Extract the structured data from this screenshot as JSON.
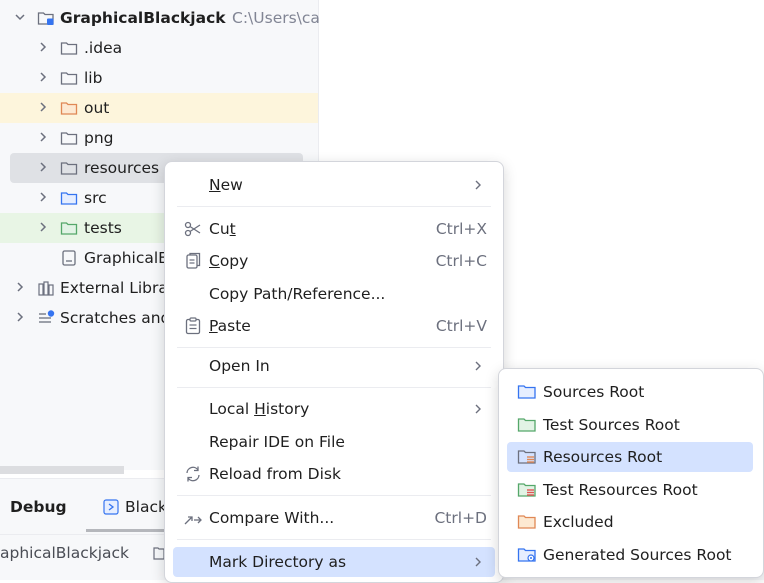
{
  "project_tree": {
    "root": {
      "name": "GraphicalBlackjack",
      "path": "C:\\Users\\ca"
    },
    "items": [
      {
        "label": ".idea",
        "icon": "folder-icon"
      },
      {
        "label": "lib",
        "icon": "folder-icon"
      },
      {
        "label": "out",
        "icon": "excluded-folder-icon"
      },
      {
        "label": "png",
        "icon": "folder-icon"
      },
      {
        "label": "resources",
        "icon": "folder-icon"
      },
      {
        "label": "src",
        "icon": "source-folder-icon"
      },
      {
        "label": "tests",
        "icon": "test-folder-icon"
      },
      {
        "label": "GraphicalBl",
        "icon": "file-icon"
      }
    ],
    "external_libraries": "External Libra",
    "scratches": "Scratches and"
  },
  "bottom": {
    "tab_debug": "Debug",
    "tab_blackjack": "Black",
    "breadcrumb": "aphicalBlackjack"
  },
  "context_menu": {
    "new": {
      "pre": "",
      "u": "N",
      "post": "ew"
    },
    "cut": {
      "pre": "Cu",
      "u": "t",
      "post": "",
      "shortcut": "Ctrl+X"
    },
    "copy": {
      "pre": "",
      "u": "C",
      "post": "opy",
      "shortcut": "Ctrl+C"
    },
    "copy_path": "Copy Path/Reference...",
    "paste": {
      "pre": "",
      "u": "P",
      "post": "aste",
      "shortcut": "Ctrl+V"
    },
    "open_in": "Open In",
    "local_history": {
      "pre": "Local ",
      "u": "H",
      "post": "istory"
    },
    "repair_ide": "Repair IDE on File",
    "reload": "Reload from Disk",
    "compare": {
      "label": "Compare With...",
      "shortcut": "Ctrl+D"
    },
    "mark_directory": "Mark Directory as"
  },
  "mark_submenu": {
    "items": [
      {
        "label": "Sources Root",
        "color": "#3574f0"
      },
      {
        "label": "Test Sources Root",
        "color": "#55a76a"
      },
      {
        "label": "Resources Root",
        "color": "#6c707e"
      },
      {
        "label": "Test Resources Root",
        "color": "#55a76a"
      },
      {
        "label": "Excluded",
        "color": "#e08855"
      },
      {
        "label": "Generated Sources Root",
        "color": "#3574f0"
      }
    ],
    "highlighted": "Resources Root"
  }
}
